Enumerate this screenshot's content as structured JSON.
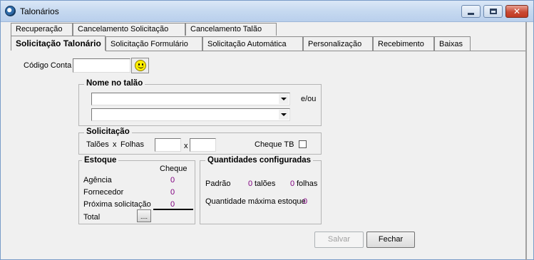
{
  "window": {
    "title": "Talonários"
  },
  "tabs_row1": [
    "Recuperação",
    "Cancelamento Solicitação",
    "Cancelamento Talão"
  ],
  "tabs_row2": [
    "Solicitação Talonário",
    "Solicitação Formulário",
    "Solicitação Automática",
    "Personalização",
    "Recebimento",
    "Baixas"
  ],
  "form": {
    "codigo_conta_label": "Código Conta",
    "codigo_conta_value": "",
    "nome_group_title": "Nome no talão",
    "eou_label": "e/ou",
    "nome_combo1_value": "",
    "nome_combo2_value": ""
  },
  "solicitacao": {
    "title": "Solicitação",
    "taloes_label": "Talões",
    "x_label_1": "x",
    "folhas_label": "Folhas",
    "x_label_2": "x",
    "taloes_value": "",
    "folhas_value": "",
    "cheque_tb_label": "Cheque TB"
  },
  "estoque": {
    "title": "Estoque",
    "column_header": "Cheque",
    "rows": [
      {
        "label": "Agência",
        "value": "0"
      },
      {
        "label": "Fornecedor",
        "value": "0"
      },
      {
        "label": "Próxima solicitação",
        "value": "0"
      }
    ],
    "total_label": "Total",
    "total_button_label": "...."
  },
  "quantidades": {
    "title": "Quantidades configuradas",
    "padrao_label": "Padrão",
    "taloes_value": "0",
    "taloes_unit": "talões",
    "folhas_value": "0",
    "folhas_unit": "folhas",
    "max_label": "Quantidade máxima estoque",
    "max_value": "0"
  },
  "buttons": {
    "salvar": "Salvar",
    "fechar": "Fechar"
  },
  "colors": {
    "value_purple": "#800080",
    "close_red": "#c94a34",
    "titlebar_blue": "#c6d9f0"
  }
}
